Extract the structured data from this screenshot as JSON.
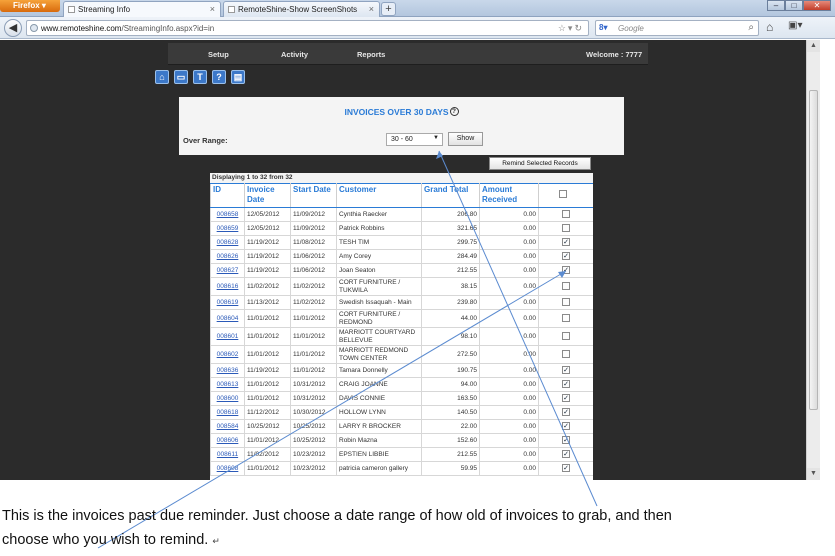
{
  "browser": {
    "app_button": "Firefox",
    "tabs": [
      {
        "label": "Streaming Info",
        "active": true
      },
      {
        "label": "RemoteShine-Show ScreenShots",
        "active": false
      }
    ],
    "url_host": "www.remoteshine.com",
    "url_path": "/StreamingInfo.aspx?id=in",
    "search_placeholder": "Google"
  },
  "site_nav": {
    "items": [
      "Setup",
      "Activity",
      "Reports"
    ],
    "welcome": "Welcome : 7777"
  },
  "icons": [
    "home-icon",
    "monitor-icon",
    "cart-icon",
    "help-icon",
    "document-icon"
  ],
  "panel": {
    "title": "INVOICES OVER 30 DAYS",
    "help_glyph": "?",
    "range_label": "Over Range:",
    "range_value": "30 - 60",
    "show_button": "Show"
  },
  "remind_button": "Remind Selected Records",
  "grid": {
    "displaying": "Displaying 1 to 32 from 32",
    "columns": [
      "ID",
      "Invoice Date",
      "Start Date",
      "Customer",
      "Grand Total",
      "Amount Received"
    ],
    "rows": [
      {
        "id": "008658",
        "invoice_date": "12/05/2012",
        "start_date": "11/09/2012",
        "customer": "Cynthia Raecker",
        "total": "206.80",
        "received": "0.00",
        "checked": false,
        "tall": false
      },
      {
        "id": "008659",
        "invoice_date": "12/05/2012",
        "start_date": "11/09/2012",
        "customer": "Patrick Robbins",
        "total": "321.65",
        "received": "0.00",
        "checked": false,
        "tall": false
      },
      {
        "id": "008628",
        "invoice_date": "11/19/2012",
        "start_date": "11/08/2012",
        "customer": "TESH TIM",
        "total": "299.75",
        "received": "0.00",
        "checked": true,
        "tall": false
      },
      {
        "id": "008626",
        "invoice_date": "11/19/2012",
        "start_date": "11/06/2012",
        "customer": "Amy Corey",
        "total": "284.49",
        "received": "0.00",
        "checked": true,
        "tall": false
      },
      {
        "id": "008627",
        "invoice_date": "11/19/2012",
        "start_date": "11/06/2012",
        "customer": "Joan Seaton",
        "total": "212.55",
        "received": "0.00",
        "checked": true,
        "tall": false
      },
      {
        "id": "008616",
        "invoice_date": "11/02/2012",
        "start_date": "11/02/2012",
        "customer": "CORT FURNITURE / TUKWILA",
        "total": "38.15",
        "received": "0.00",
        "checked": false,
        "tall": true
      },
      {
        "id": "008619",
        "invoice_date": "11/13/2012",
        "start_date": "11/02/2012",
        "customer": "Swedish Issaquah - Main",
        "total": "239.80",
        "received": "0.00",
        "checked": false,
        "tall": false
      },
      {
        "id": "008604",
        "invoice_date": "11/01/2012",
        "start_date": "11/01/2012",
        "customer": "CORT FURNITURE / REDMOND",
        "total": "44.00",
        "received": "0.00",
        "checked": false,
        "tall": true
      },
      {
        "id": "008601",
        "invoice_date": "11/01/2012",
        "start_date": "11/01/2012",
        "customer": "MARRIOTT COURTYARD BELLEVUE",
        "total": "98.10",
        "received": "0.00",
        "checked": false,
        "tall": true
      },
      {
        "id": "008602",
        "invoice_date": "11/01/2012",
        "start_date": "11/01/2012",
        "customer": "MARRIOTT REDMOND TOWN CENTER",
        "total": "272.50",
        "received": "0.00",
        "checked": false,
        "tall": true
      },
      {
        "id": "008636",
        "invoice_date": "11/19/2012",
        "start_date": "11/01/2012",
        "customer": "Tamara Donnelly",
        "total": "190.75",
        "received": "0.00",
        "checked": true,
        "tall": false
      },
      {
        "id": "008613",
        "invoice_date": "11/01/2012",
        "start_date": "10/31/2012",
        "customer": "CRAIG JOANNE",
        "total": "94.00",
        "received": "0.00",
        "checked": true,
        "tall": false
      },
      {
        "id": "008600",
        "invoice_date": "11/01/2012",
        "start_date": "10/31/2012",
        "customer": "DAVIS CONNIE",
        "total": "163.50",
        "received": "0.00",
        "checked": true,
        "tall": false
      },
      {
        "id": "008618",
        "invoice_date": "11/12/2012",
        "start_date": "10/30/2012",
        "customer": "HOLLOW LYNN",
        "total": "140.50",
        "received": "0.00",
        "checked": true,
        "tall": false
      },
      {
        "id": "008584",
        "invoice_date": "10/25/2012",
        "start_date": "10/25/2012",
        "customer": "LARRY R BROCKER",
        "total": "22.00",
        "received": "0.00",
        "checked": true,
        "tall": false
      },
      {
        "id": "008606",
        "invoice_date": "11/01/2012",
        "start_date": "10/25/2012",
        "customer": "Robin Mazna",
        "total": "152.60",
        "received": "0.00",
        "checked": true,
        "tall": false
      },
      {
        "id": "008611",
        "invoice_date": "11/02/2012",
        "start_date": "10/23/2012",
        "customer": "EPSTIEN LIBBIE",
        "total": "212.55",
        "received": "0.00",
        "checked": true,
        "tall": false
      },
      {
        "id": "008608",
        "invoice_date": "11/01/2012",
        "start_date": "10/23/2012",
        "customer": "patricia cameron gallery",
        "total": "59.95",
        "received": "0.00",
        "checked": true,
        "tall": false
      }
    ]
  },
  "caption": {
    "line1": "This is the invoices past due reminder. Just choose a date range of how old of invoices to grab, and then",
    "line2": "choose who you wish to remind."
  },
  "colors": {
    "page_bg": "#2b2b2b",
    "accent_blue": "#2a7bd6",
    "link_blue": "#2a59b8"
  }
}
